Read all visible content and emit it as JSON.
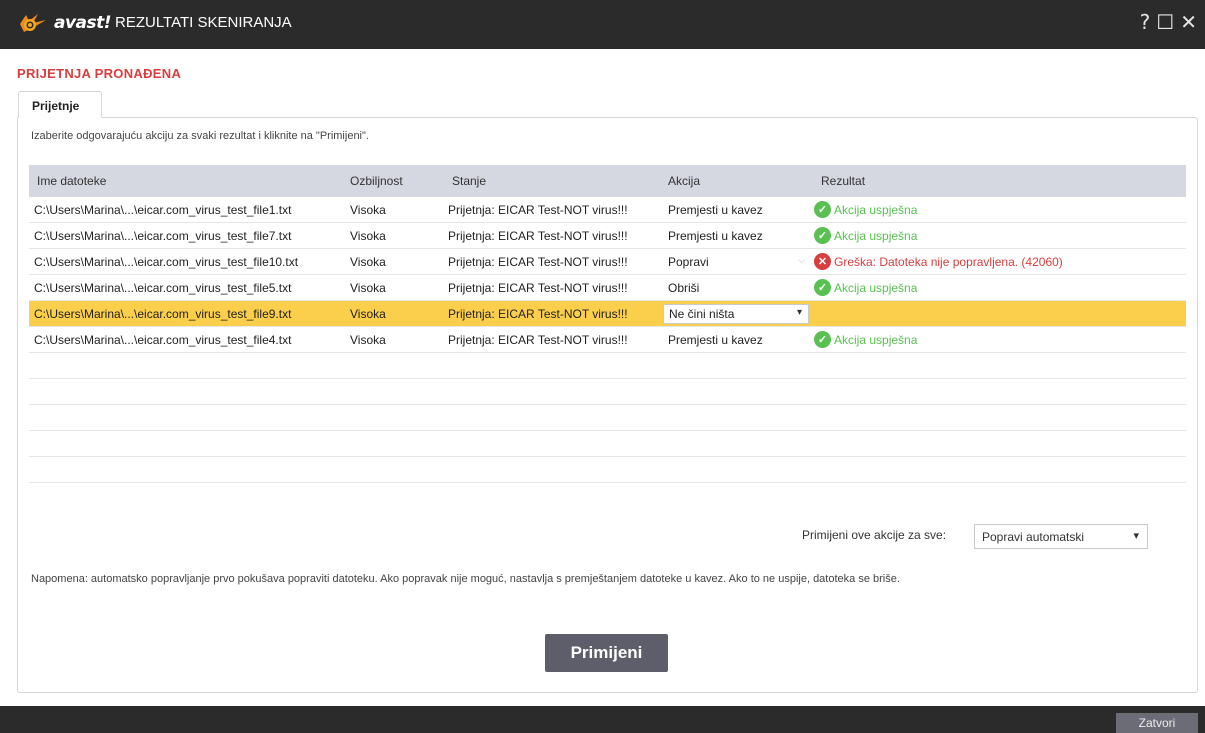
{
  "window": {
    "brand": "avast!",
    "title": "REZULTATI SKENIRANJA",
    "controls": {
      "help": "?",
      "maximize": "☐",
      "close": "✕"
    }
  },
  "heading": "PRIJETNJA PRONAĐENA",
  "tab_label": "Prijetnje",
  "instruction": "Izaberite odgovarajuću akciju za svaki rezultat i kliknite na \"Primijeni\".",
  "table": {
    "headers": [
      "Ime datoteke",
      "Ozbiljnost",
      "Stanje",
      "Akcija",
      "Rezultat"
    ],
    "rows": [
      {
        "file": "C:\\Users\\Marina\\...\\eicar.com_virus_test_file1.txt",
        "severity": "Visoka",
        "status": "Prijetnja: EICAR Test-NOT virus!!!",
        "action": "Premjesti u kavez",
        "result": "Akcija uspješna"
      },
      {
        "file": "C:\\Users\\Marina\\...\\eicar.com_virus_test_file7.txt",
        "severity": "Visoka",
        "status": "Prijetnja: EICAR Test-NOT virus!!!",
        "action": "Premjesti u kavez",
        "result": "Akcija uspješna"
      },
      {
        "file": "C:\\Users\\Marina\\...\\eicar.com_virus_test_file10.txt",
        "severity": "Visoka",
        "status": "Prijetnja: EICAR Test-NOT virus!!!",
        "action": "Popravi",
        "result": "Greška: Datoteka nije popravljena. (42060)"
      },
      {
        "file": "C:\\Users\\Marina\\...\\eicar.com_virus_test_file5.txt",
        "severity": "Visoka",
        "status": "Prijetnja: EICAR Test-NOT virus!!!",
        "action": "Obriši",
        "result": "Akcija uspješna"
      },
      {
        "file": "C:\\Users\\Marina\\...\\eicar.com_virus_test_file9.txt",
        "severity": "Visoka",
        "status": "Prijetnja: EICAR Test-NOT virus!!!",
        "action": "Ne čini ništa",
        "result": ""
      },
      {
        "file": "C:\\Users\\Marina\\...\\eicar.com_virus_test_file4.txt",
        "severity": "Visoka",
        "status": "Prijetnja: EICAR Test-NOT virus!!!",
        "action": "Premjesti u kavez",
        "result": "Akcija uspješna"
      }
    ]
  },
  "apply_all": {
    "label": "Primijeni ove akcije za sve:",
    "value": "Popravi automatski"
  },
  "note": "Napomena: automatsko popravljanje prvo pokušava popraviti datoteku. Ako popravak nije moguć, nastavlja s premještanjem datoteke u kavez. Ako to ne uspije, datoteka se briše.",
  "apply_button": "Primijeni",
  "close_button": "Zatvori",
  "icons": {
    "success": "check-circle-icon",
    "error": "x-circle-icon",
    "dropdown": "chevron-down-icon"
  },
  "colors": {
    "accent_red": "#d93d3d",
    "success_green": "#59c152",
    "selected_row": "#fbcf4b",
    "header_bg": "#d5d7e1",
    "titlebar": "#2b2b2b"
  }
}
